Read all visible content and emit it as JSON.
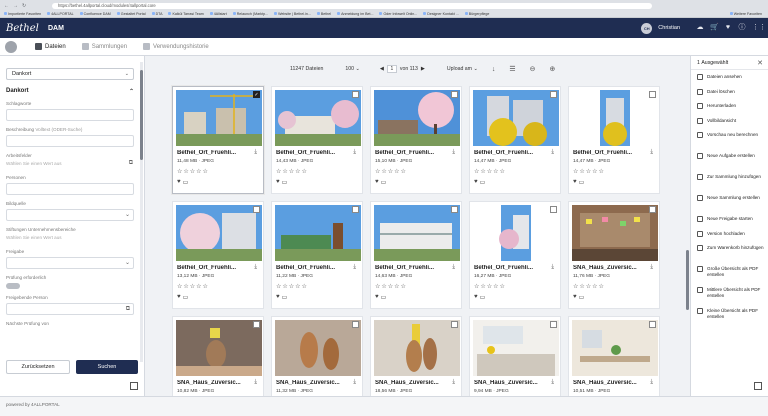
{
  "browser": {
    "url": "https://bethel.4allportal.cloud/modules/4allportal.core",
    "bookmarks": [
      "Importierte Favoriten",
      "4ALLPORTAL",
      "Confluence DAM",
      "Gestaltet Portal",
      "DTA",
      "Kalkül Tarrasi Team",
      "4Allstart",
      "Relaunch (Marktp...",
      "Website | Bethel.in...",
      "Bethel",
      "Anmeldung im Bet...",
      "Oder Infowelt Onlin...",
      "Designer Kontakt ...",
      "Bürgerpflege ",
      "Weitere Favoriten"
    ]
  },
  "header": {
    "logo": "Bethel",
    "app_name": "DAM",
    "avatar_initials": "CH",
    "user_name": "Christian",
    "icons": [
      "cloud-upload-icon",
      "cart-icon",
      "heart-icon",
      "info-icon",
      "grid-menu-icon"
    ]
  },
  "tabs": [
    {
      "label": "Dateien",
      "active": true
    },
    {
      "label": "Sammlungen",
      "active": false
    },
    {
      "label": "Verwendungshistorie",
      "active": false
    }
  ],
  "filters": {
    "dropdown_value": "Dankort",
    "section_title": "Dankort",
    "fields": {
      "schlagworte": "Schlagworte",
      "beschreibung": "Beschreibung",
      "beschreibung_sub": "Volltext (ODER-Suche)",
      "arbeitsfelder": "Arbeitsfelder",
      "arbeitsfelder_placeholder": "Wählen Sie einen Wert aus",
      "personen": "Personen",
      "bildquelle": "Bildquelle",
      "stiftungen": "Stiftungen Unternehmensbereiche",
      "stiftungen_placeholder": "Wählen Sie einen Wert aus",
      "freigabe": "Freigabe",
      "pruefung": "Prüfung erforderlich",
      "freigebende": "Freigebende Person",
      "naechste": "Nächste Prüfung von"
    },
    "reset_label": "Zurücksetzen",
    "search_label": "Suchen"
  },
  "toolbar": {
    "count": "11247",
    "count_label": "Dateien",
    "per_page": "100",
    "page": "1",
    "page_of": "von 113",
    "sort": "Upload am"
  },
  "files": [
    {
      "name": "Bethel_Ort_Fruehli...",
      "size": "11,48 MB",
      "type": "JPEG",
      "selected": true,
      "scene": "crane"
    },
    {
      "name": "Bethel_Ort_Fruehli...",
      "size": "14,43 MB",
      "type": "JPEG",
      "selected": false,
      "scene": "house-blossom"
    },
    {
      "name": "Bethel_Ort_Fruehli...",
      "size": "15,10 MB",
      "type": "JPEG",
      "selected": false,
      "scene": "cherry"
    },
    {
      "name": "Bethel_Ort_Fruehli...",
      "size": "14,47 MB",
      "type": "JPEG",
      "selected": false,
      "scene": "yellow-tree"
    },
    {
      "name": "Bethel_Ort_Fruehli...",
      "size": "14,47 MB",
      "type": "JPEG",
      "selected": false,
      "scene": "yellow-narrow"
    },
    {
      "name": "Bethel_Ort_Fruehli...",
      "size": "13,12 MB",
      "type": "JPEG",
      "selected": false,
      "scene": "blossom-block"
    },
    {
      "name": "Bethel_Ort_Fruehli...",
      "size": "11,22 MB",
      "type": "JPEG",
      "selected": false,
      "scene": "green-building"
    },
    {
      "name": "Bethel_Ort_Fruehli...",
      "size": "14,63 MB",
      "type": "JPEG",
      "selected": false,
      "scene": "white-building"
    },
    {
      "name": "Bethel_Ort_Fruehli...",
      "size": "16,27 MB",
      "type": "JPEG",
      "selected": false,
      "scene": "pink-narrow"
    },
    {
      "name": "SNA_Haus_Zuversic...",
      "size": "11,76 MB",
      "type": "JPEG",
      "selected": false,
      "scene": "room-notes"
    },
    {
      "name": "SNA_Haus_Zuversic...",
      "size": "10,82 MB",
      "type": "JPEG",
      "selected": false,
      "scene": "sculpture-small"
    },
    {
      "name": "SNA_Haus_Zuversic...",
      "size": "11,32 MB",
      "type": "JPEG",
      "selected": false,
      "scene": "sculpture-wood"
    },
    {
      "name": "SNA_Haus_Zuversic...",
      "size": "18,56 MB",
      "type": "JPEG",
      "selected": false,
      "scene": "sculpture-pair"
    },
    {
      "name": "SNA_Haus_Zuversic...",
      "size": "9,94 MB",
      "type": "JPEG",
      "selected": false,
      "scene": "kitchen"
    },
    {
      "name": "SNA_Haus_Zuversic...",
      "size": "10,51 MB",
      "type": "JPEG",
      "selected": false,
      "scene": "dining"
    }
  ],
  "right_panel": {
    "selected_count": "1",
    "selected_label": "Ausgewählt",
    "actions": [
      {
        "label": "Dateien ansehen",
        "icon": "eye-icon"
      },
      {
        "label": "Datei löschen",
        "icon": "trash-icon"
      },
      {
        "label": "Herunterladen",
        "icon": "download-icon"
      },
      {
        "label": "Vollbildansicht",
        "icon": "fullscreen-icon"
      },
      {
        "label": "Vorschau neu berechnen",
        "icon": "preview-icon"
      },
      {
        "label": "Neue Aufgabe erstellen",
        "icon": "task-icon"
      },
      {
        "label": "Zur Sammlung hinzufügen",
        "icon": "collection-add-icon"
      },
      {
        "label": "Neue Sammlung erstellen",
        "icon": "collection-new-icon"
      },
      {
        "label": "Neue Freigabe starten",
        "icon": "share-icon"
      },
      {
        "label": "Version hochladen",
        "icon": "upload-icon"
      },
      {
        "label": "Zum Warenkorb hinzufügen",
        "icon": "cart-add-icon"
      },
      {
        "label": "Große Übersicht als PDF erstellen",
        "icon": "pdf-large-icon"
      },
      {
        "label": "Mittlere Übersicht als PDF erstellen",
        "icon": "pdf-medium-icon"
      },
      {
        "label": "Kleine Übersicht als PDF erstellen",
        "icon": "pdf-small-icon"
      }
    ]
  },
  "footer": {
    "powered": "powered by 4ALLPORTAL"
  }
}
